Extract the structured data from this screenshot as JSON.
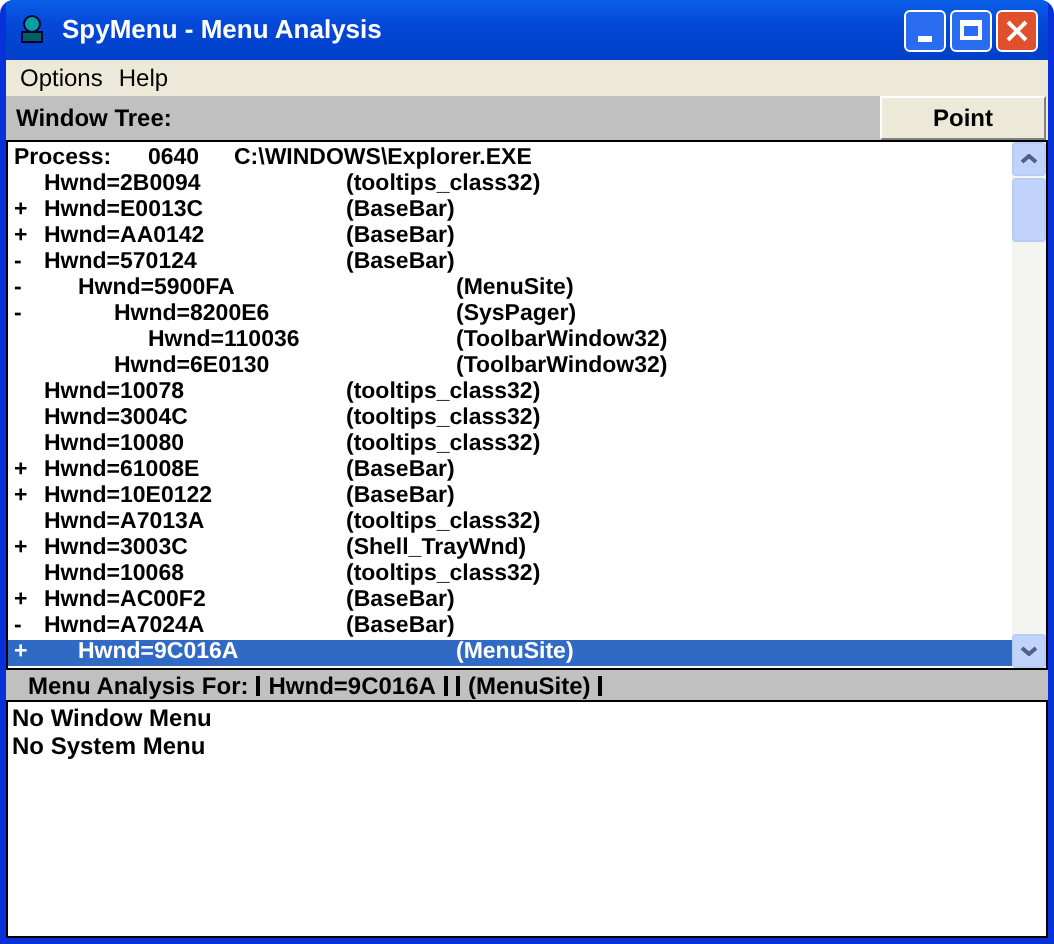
{
  "window": {
    "title": "SpyMenu - Menu Analysis"
  },
  "menu": [
    "Options",
    "Help"
  ],
  "tree_header": {
    "label": "Window Tree:",
    "button": "Point"
  },
  "process": {
    "label": "Process:",
    "pid": "0640",
    "path": "C:\\WINDOWS\\Explorer.EXE"
  },
  "tree": {
    "items": [
      {
        "hwnd": "Hwnd=2B0094",
        "class": "(tooltips_class32)",
        "selected": false
      },
      {
        "sign": "+",
        "hwnd": "Hwnd=E0013C",
        "class": "(BaseBar)",
        "selected": false
      },
      {
        "sign": "+",
        "hwnd": "Hwnd=AA0142",
        "class": "(BaseBar)",
        "selected": false
      },
      {
        "sign": "-",
        "hwnd": "Hwnd=570124",
        "class": "(BaseBar)",
        "selected": false,
        "children": [
          {
            "sign": "-",
            "hwnd": "Hwnd=5900FA",
            "class": "(MenuSite)",
            "selected": false,
            "children": [
              {
                "sign": "-",
                "hwnd": "Hwnd=8200E6",
                "class": "(SysPager)",
                "selected": false,
                "children": [
                  {
                    "hwnd": "Hwnd=110036",
                    "class": "(ToolbarWindow32)",
                    "selected": false
                  }
                ]
              },
              {
                "hwnd": "Hwnd=6E0130",
                "class": "(ToolbarWindow32)",
                "selected": false
              }
            ]
          }
        ]
      },
      {
        "hwnd": "Hwnd=10078",
        "class": "(tooltips_class32)",
        "selected": false
      },
      {
        "hwnd": "Hwnd=3004C",
        "class": "(tooltips_class32)",
        "selected": false
      },
      {
        "hwnd": "Hwnd=10080",
        "class": "(tooltips_class32)",
        "selected": false
      },
      {
        "sign": "+",
        "hwnd": "Hwnd=61008E",
        "class": "(BaseBar)",
        "selected": false
      },
      {
        "sign": "+",
        "hwnd": "Hwnd=10E0122",
        "class": "(BaseBar)",
        "selected": false
      },
      {
        "hwnd": "Hwnd=A7013A",
        "class": "(tooltips_class32)",
        "selected": false
      },
      {
        "sign": "+",
        "hwnd": "Hwnd=3003C",
        "class": "(Shell_TrayWnd)",
        "selected": false
      },
      {
        "hwnd": "Hwnd=10068",
        "class": "(tooltips_class32)",
        "selected": false
      },
      {
        "sign": "+",
        "hwnd": "Hwnd=AC00F2",
        "class": "(BaseBar)",
        "selected": false
      },
      {
        "sign": "-",
        "hwnd": "Hwnd=A7024A",
        "class": "(BaseBar)",
        "selected": false,
        "children": [
          {
            "sign": "+",
            "hwnd": "Hwnd=9C016A",
            "class": "(MenuSite)",
            "selected": true
          }
        ]
      }
    ]
  },
  "analysis": {
    "label": "Menu Analysis For:",
    "hwnd": "Hwnd=9C016A",
    "class": "(MenuSite)",
    "lines": [
      "No Window Menu",
      "No System Menu"
    ]
  }
}
